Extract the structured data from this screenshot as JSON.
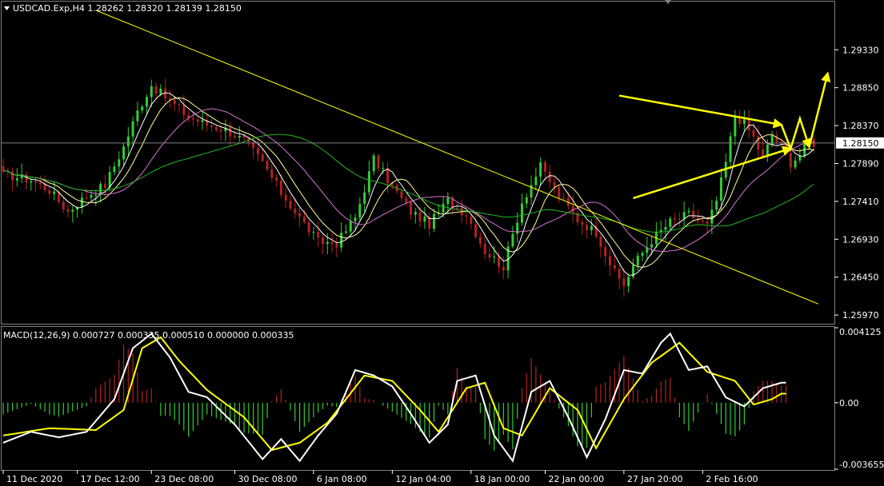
{
  "header": {
    "symbol_line": "USDCAD.Exp,H4  1.28262 1.28320 1.28139 1.28150",
    "collapse_icon": "triangle-down-icon"
  },
  "colors": {
    "background": "#000000",
    "bull": "#32cd32",
    "bear": "#b22222",
    "ma_fast": "#ffffff",
    "ma_mid": "#ffff99",
    "ma_slow": "#da70d6",
    "ma_long": "#22b822",
    "trend": "#ffff00",
    "macd_line": "#ffffff",
    "signal_line": "#ffff00",
    "grid": "#808080"
  },
  "chart_data": [
    {
      "type": "candlestick",
      "title": "USDCAD.Exp,H4",
      "ohlc_readout": [
        1.28262,
        1.2832,
        1.28139,
        1.2815
      ],
      "current_price": 1.2815,
      "current_price_label": "1.28150",
      "ylim": [
        1.2587,
        1.2992
      ],
      "y_ticks": [
        1.2933,
        1.2885,
        1.2837,
        1.2789,
        1.2741,
        1.2693,
        1.2645,
        1.2597
      ],
      "y_tick_labels": [
        "1.29330",
        "1.28850",
        "1.28370",
        "1.27890",
        "1.27410",
        "1.26930",
        "1.26450",
        "1.25970"
      ],
      "x_labels": [
        "11 Dec 2020",
        "17 Dec 12:00",
        "23 Dec 08:00",
        "30 Dec 08:00",
        "6 Jan 08:00",
        "12 Jan 04:00",
        "18 Jan 00:00",
        "22 Jan 00:00",
        "27 Jan 20:00",
        "2 Feb 16:00"
      ],
      "bars": 176,
      "close_path": [
        [
          0,
          1.2775
        ],
        [
          6,
          1.2768
        ],
        [
          10,
          1.2755
        ],
        [
          14,
          1.2728
        ],
        [
          18,
          1.2748
        ],
        [
          22,
          1.2762
        ],
        [
          26,
          1.281
        ],
        [
          29,
          1.2855
        ],
        [
          32,
          1.2888
        ],
        [
          36,
          1.2868
        ],
        [
          40,
          1.2848
        ],
        [
          44,
          1.2838
        ],
        [
          48,
          1.2832
        ],
        [
          52,
          1.2818
        ],
        [
          56,
          1.279
        ],
        [
          60,
          1.2752
        ],
        [
          64,
          1.272
        ],
        [
          68,
          1.269
        ],
        [
          72,
          1.2688
        ],
        [
          76,
          1.272
        ],
        [
          80,
          1.2795
        ],
        [
          84,
          1.276
        ],
        [
          88,
          1.2728
        ],
        [
          92,
          1.2712
        ],
        [
          96,
          1.2742
        ],
        [
          100,
          1.2725
        ],
        [
          104,
          1.2678
        ],
        [
          108,
          1.2658
        ],
        [
          112,
          1.274
        ],
        [
          116,
          1.2785
        ],
        [
          120,
          1.2748
        ],
        [
          124,
          1.2718
        ],
        [
          128,
          1.2702
        ],
        [
          132,
          1.265
        ],
        [
          134,
          1.2635
        ],
        [
          136,
          1.266
        ],
        [
          140,
          1.2692
        ],
        [
          144,
          1.2715
        ],
        [
          148,
          1.2725
        ],
        [
          152,
          1.271
        ],
        [
          154,
          1.2742
        ],
        [
          156,
          1.279
        ],
        [
          158,
          1.285
        ],
        [
          160,
          1.284
        ],
        [
          162,
          1.2822
        ],
        [
          164,
          1.2795
        ],
        [
          166,
          1.2825
        ],
        [
          168,
          1.281
        ],
        [
          170,
          1.279
        ],
        [
          172,
          1.28
        ],
        [
          174,
          1.2818
        ],
        [
          175,
          1.2815
        ]
      ],
      "trendlines": [
        {
          "from": [
            20,
            1.2983
          ],
          "to": [
            176,
            1.2611
          ]
        },
        {
          "from": [
            133,
            1.2875
          ],
          "to": [
            168,
            1.2838
          ]
        },
        {
          "from": [
            136,
            1.2745
          ],
          "to": [
            170,
            1.2808
          ]
        }
      ],
      "forecast_arrows": [
        [
          [
            168,
            1.2838
          ],
          [
            170,
            1.2808
          ],
          [
            172,
            1.2846
          ],
          [
            174,
            1.281
          ]
        ],
        [
          [
            174,
            1.281
          ],
          [
            178,
            1.2903
          ]
        ]
      ]
    },
    {
      "type": "macd",
      "title": "MACD(12,26,9) 0.000727 0.000335 0.000510 0.000000 0.000335",
      "params": [
        12,
        26,
        9
      ],
      "ylim": [
        -0.003655,
        0.004125
      ],
      "y_tick_labels": [
        "0.004125",
        "0.00",
        "-0.003655"
      ],
      "y_ticks": [
        0.004125,
        0.0,
        -0.003655
      ],
      "macd_path": [
        [
          0,
          -0.0022
        ],
        [
          6,
          -0.0016
        ],
        [
          12,
          -0.0019
        ],
        [
          18,
          -0.0016
        ],
        [
          24,
          0.0002
        ],
        [
          28,
          0.003
        ],
        [
          32,
          0.0038
        ],
        [
          36,
          0.0025
        ],
        [
          40,
          0.0006
        ],
        [
          44,
          0.0003
        ],
        [
          50,
          -0.0012
        ],
        [
          56,
          -0.0031
        ],
        [
          60,
          -0.002
        ],
        [
          64,
          -0.0032
        ],
        [
          68,
          -0.0018
        ],
        [
          72,
          -0.0006
        ],
        [
          76,
          0.0018
        ],
        [
          80,
          0.0015
        ],
        [
          84,
          0.0009
        ],
        [
          88,
          -0.0006
        ],
        [
          92,
          -0.0022
        ],
        [
          96,
          -0.0012
        ],
        [
          98,
          0.0012
        ],
        [
          102,
          0.0015
        ],
        [
          106,
          -0.0018
        ],
        [
          110,
          -0.0032
        ],
        [
          114,
          0.0006
        ],
        [
          118,
          0.0012
        ],
        [
          122,
          -0.0008
        ],
        [
          126,
          -0.003
        ],
        [
          130,
          -0.0009
        ],
        [
          134,
          0.0018
        ],
        [
          138,
          0.0016
        ],
        [
          142,
          0.0033
        ],
        [
          144,
          0.0038
        ],
        [
          148,
          0.0018
        ],
        [
          152,
          0.002
        ],
        [
          156,
          0.0003
        ],
        [
          160,
          -0.0002
        ],
        [
          164,
          0.0008
        ],
        [
          168,
          0.0011
        ]
      ],
      "signal_path": [
        [
          0,
          -0.0018
        ],
        [
          10,
          -0.0014
        ],
        [
          20,
          -0.0015
        ],
        [
          26,
          -0.0004
        ],
        [
          30,
          0.003
        ],
        [
          34,
          0.0036
        ],
        [
          38,
          0.0023
        ],
        [
          44,
          0.0007
        ],
        [
          52,
          -0.0008
        ],
        [
          58,
          -0.0026
        ],
        [
          64,
          -0.0022
        ],
        [
          70,
          -0.0011
        ],
        [
          78,
          0.0015
        ],
        [
          84,
          0.0012
        ],
        [
          90,
          -0.0004
        ],
        [
          94,
          -0.0016
        ],
        [
          100,
          0.0008
        ],
        [
          104,
          0.0011
        ],
        [
          108,
          -0.0014
        ],
        [
          112,
          -0.0018
        ],
        [
          118,
          0.0008
        ],
        [
          124,
          -0.0004
        ],
        [
          128,
          -0.0025
        ],
        [
          134,
          0.0002
        ],
        [
          140,
          0.0022
        ],
        [
          146,
          0.0033
        ],
        [
          152,
          0.0017
        ],
        [
          158,
          0.0012
        ],
        [
          162,
          -0.0001
        ],
        [
          166,
          0.0002
        ],
        [
          168,
          0.0005
        ]
      ]
    }
  ]
}
